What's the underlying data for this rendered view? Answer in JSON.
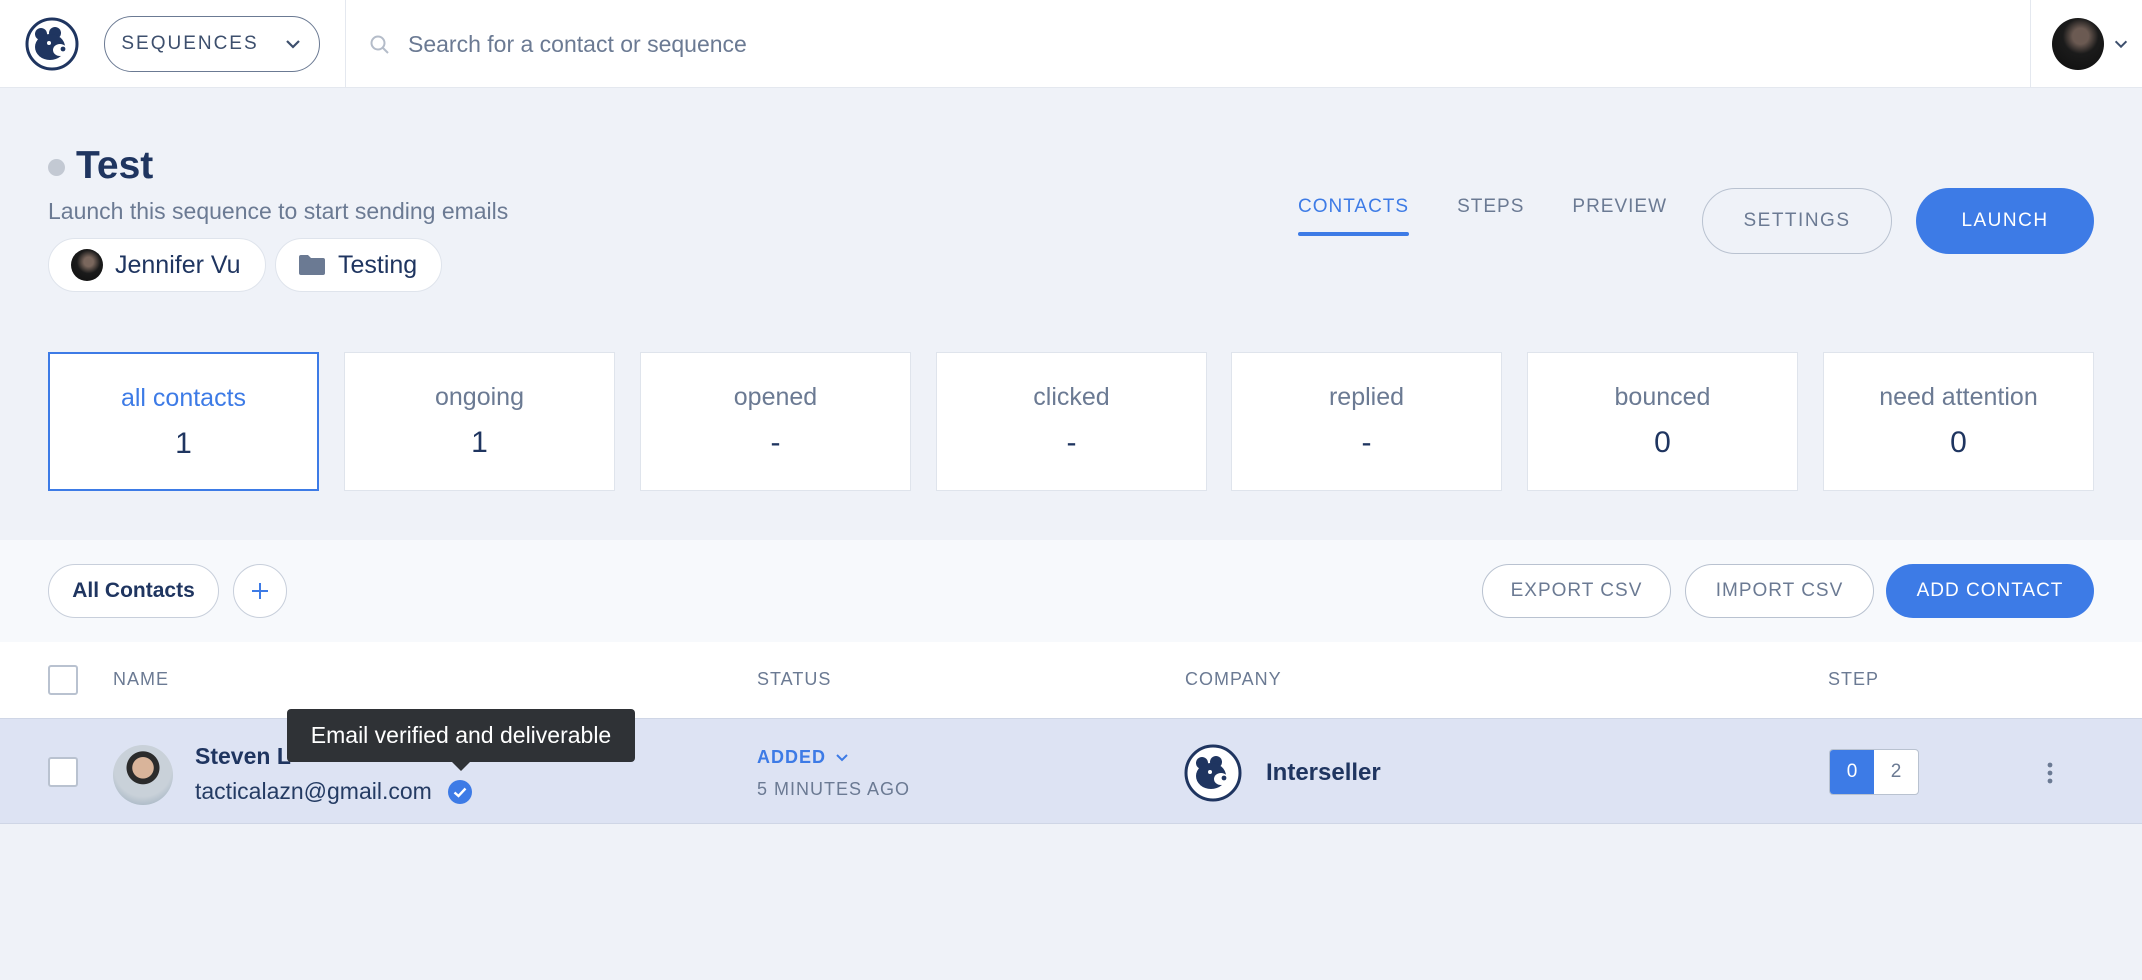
{
  "topbar": {
    "sequences_label": "SEQUENCES",
    "search_placeholder": "Search for a contact or sequence"
  },
  "sequence": {
    "title": "Test",
    "subtitle": "Launch this sequence to start sending emails",
    "owner": "Jennifer Vu",
    "folder": "Testing"
  },
  "tabs": [
    {
      "label": "CONTACTS",
      "active": true
    },
    {
      "label": "STEPS",
      "active": false
    },
    {
      "label": "PREVIEW",
      "active": false
    }
  ],
  "actions": {
    "settings": "SETTINGS",
    "launch": "LAUNCH"
  },
  "stats": [
    {
      "label": "all contacts",
      "value": "1"
    },
    {
      "label": "ongoing",
      "value": "1"
    },
    {
      "label": "opened",
      "value": "-"
    },
    {
      "label": "clicked",
      "value": "-"
    },
    {
      "label": "replied",
      "value": "-"
    },
    {
      "label": "bounced",
      "value": "0"
    },
    {
      "label": "need attention",
      "value": "0"
    }
  ],
  "filters": {
    "all_contacts": "All Contacts",
    "export_csv": "EXPORT CSV",
    "import_csv": "IMPORT CSV",
    "add_contact": "ADD CONTACT"
  },
  "table": {
    "headers": {
      "name": "NAME",
      "status": "STATUS",
      "company": "COMPANY",
      "step": "STEP"
    },
    "rows": [
      {
        "name": "Steven L",
        "email": "tacticalazn@gmail.com",
        "status": "ADDED",
        "status_time": "5 MINUTES AGO",
        "company": "Interseller",
        "step_current": "0",
        "step_total": "2"
      }
    ]
  },
  "tooltip": "Email verified and deliverable",
  "colors": {
    "accent": "#3d7be6",
    "navy": "#1f3560",
    "muted": "#6b7a93"
  }
}
